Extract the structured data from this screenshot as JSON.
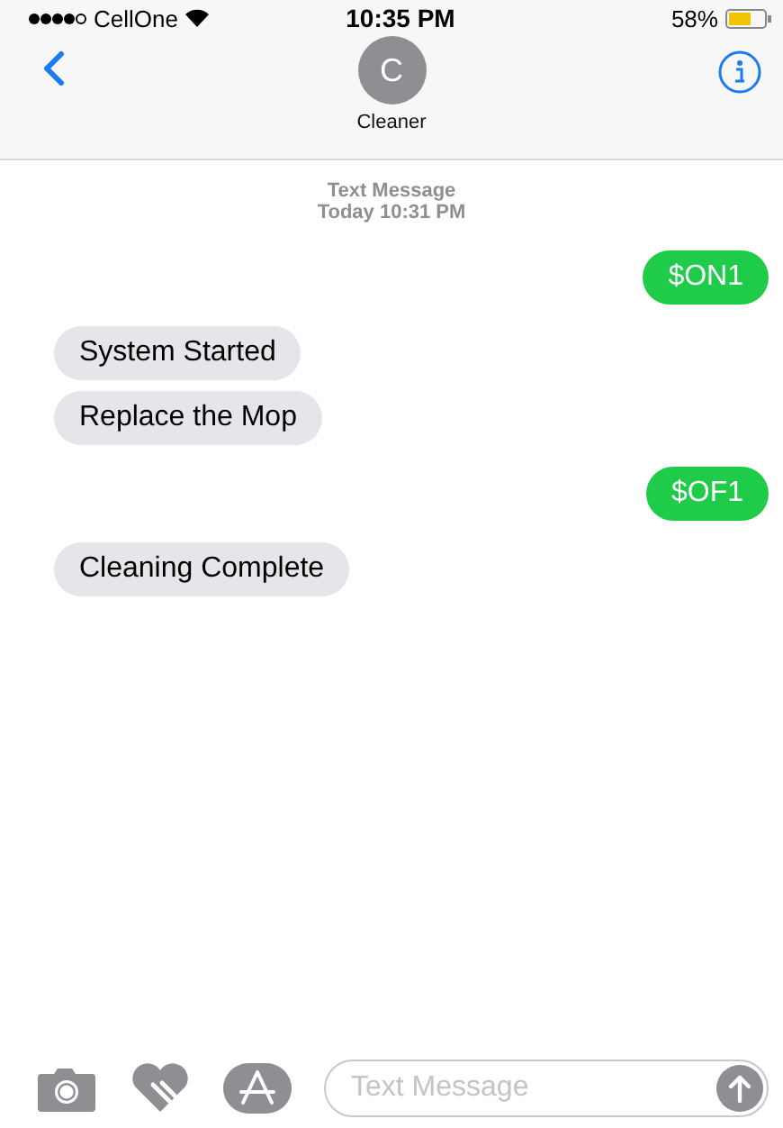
{
  "status_bar": {
    "carrier": "CellOne",
    "time": "10:35 PM",
    "battery": "58%"
  },
  "contact": {
    "initial": "C",
    "name": "Cleaner"
  },
  "timestamp": {
    "service": "Text Message",
    "time": "Today 10:31 PM"
  },
  "messages": [
    {
      "kind": "sent",
      "text": "$ON1"
    },
    {
      "kind": "received",
      "text": "System Started"
    },
    {
      "kind": "received",
      "text": "Replace the Mop"
    },
    {
      "kind": "sent",
      "text": "$OF1"
    },
    {
      "kind": "received",
      "text": "Cleaning Complete"
    }
  ],
  "composer": {
    "placeholder": "Text Message"
  }
}
